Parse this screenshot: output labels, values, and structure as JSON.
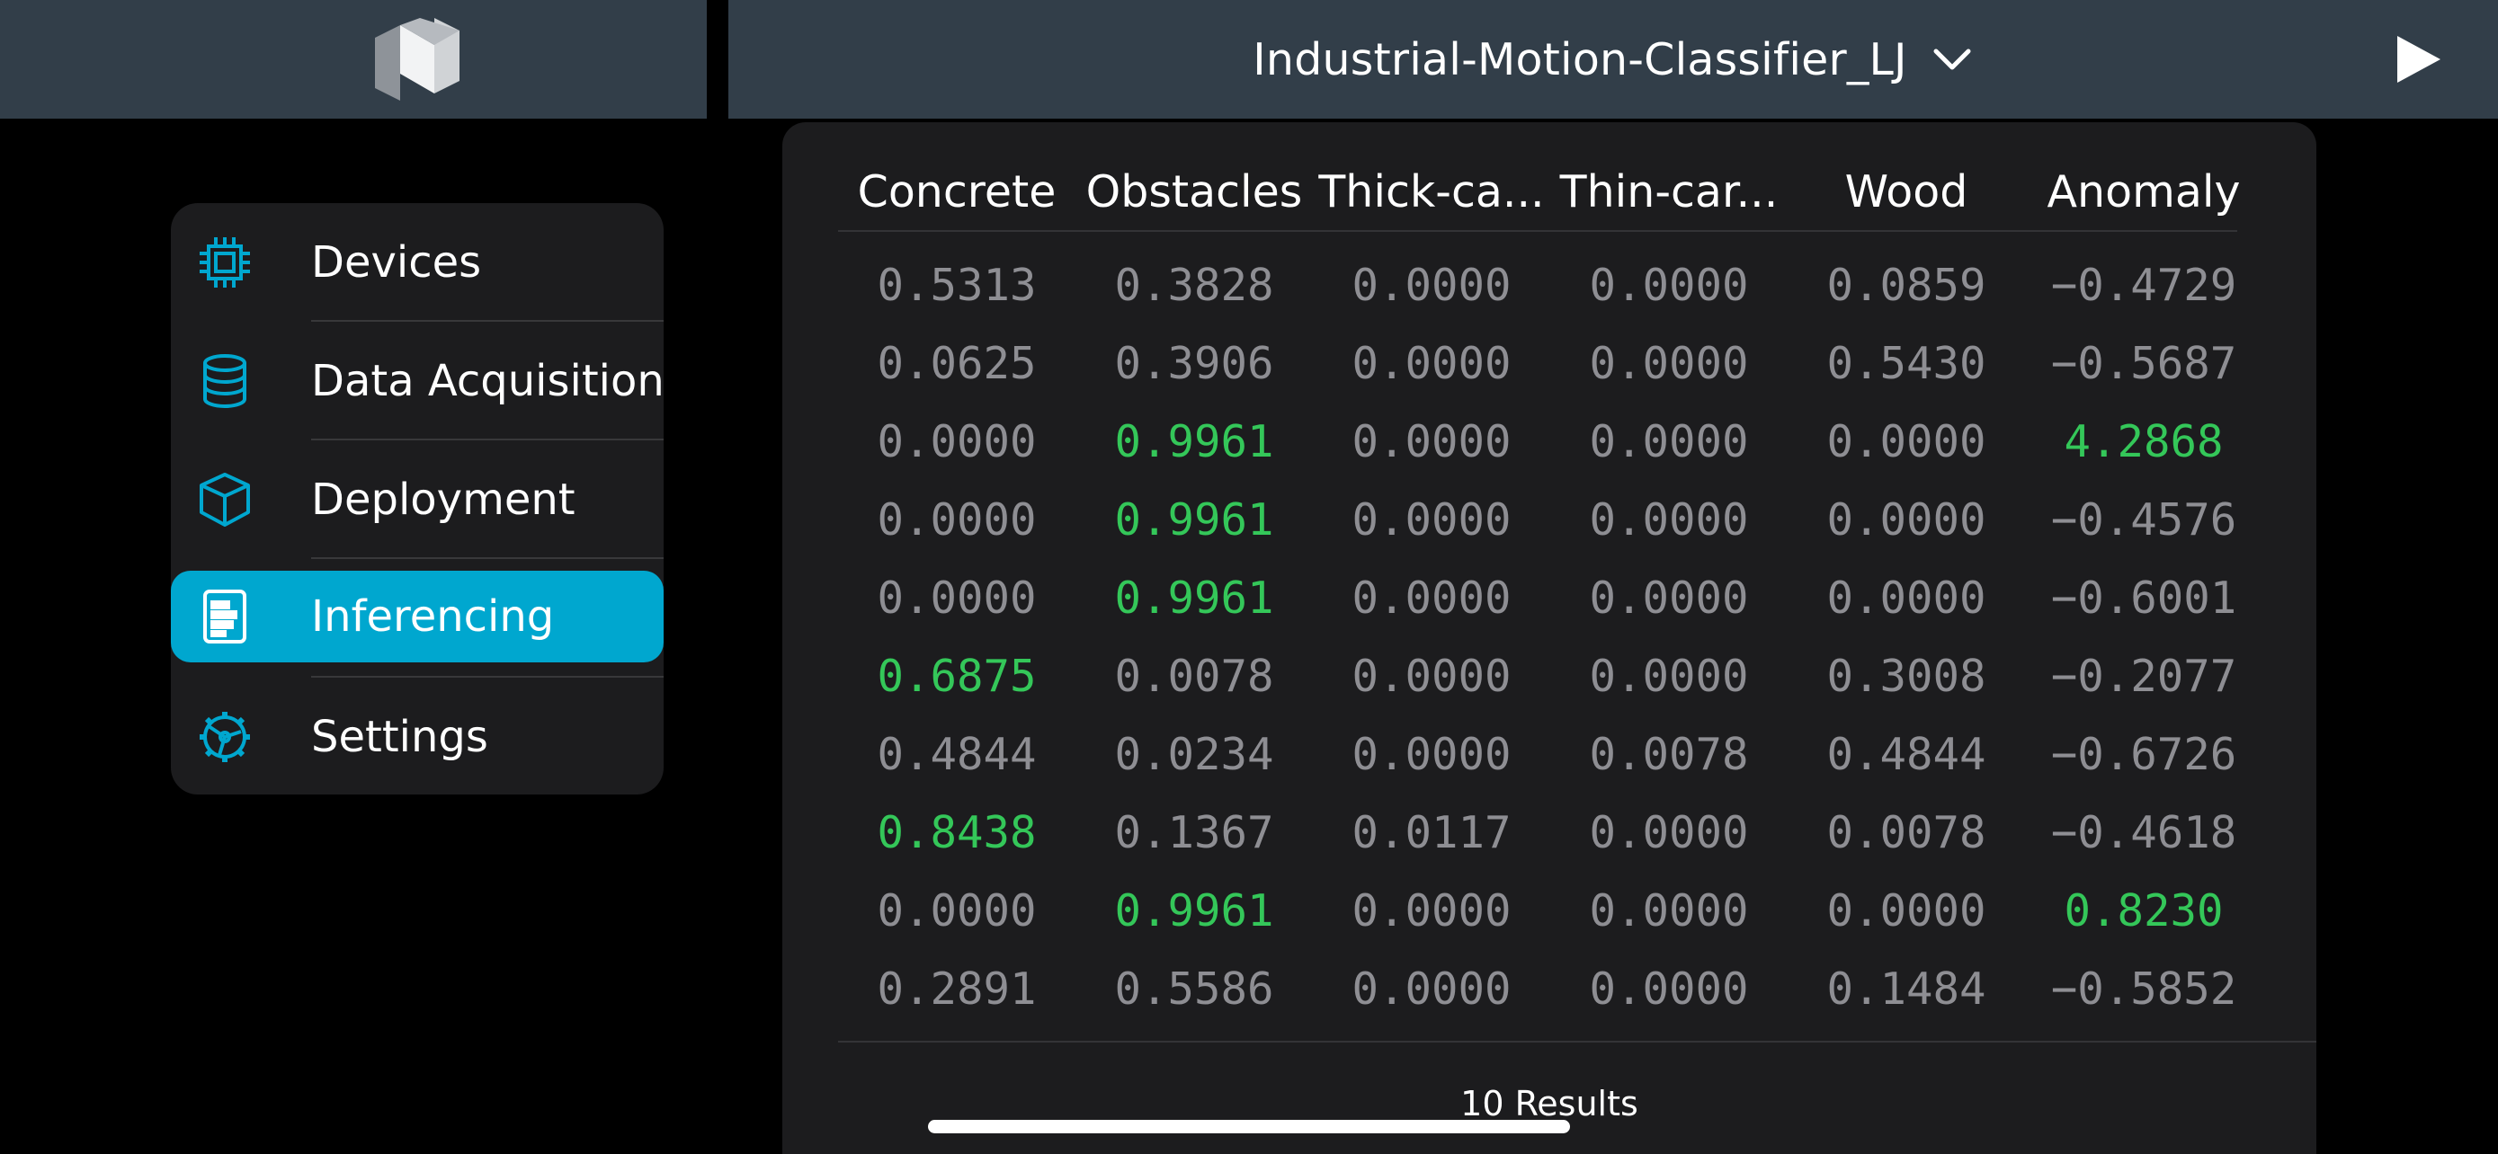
{
  "header": {
    "project_title": "Industrial-Motion-Classifier_LJ",
    "logo_icon": "edge-impulse-logo",
    "chevron_icon": "chevron-down-icon",
    "play_icon": "play-icon"
  },
  "sidebar": {
    "items": [
      {
        "label": "Devices",
        "icon": "chip-icon",
        "active": false
      },
      {
        "label": "Data Acquisition",
        "icon": "database-icon",
        "active": false
      },
      {
        "label": "Deployment",
        "icon": "box-icon",
        "active": false
      },
      {
        "label": "Inferencing",
        "icon": "report-icon",
        "active": true
      },
      {
        "label": "Settings",
        "icon": "gear-icon",
        "active": false
      }
    ]
  },
  "table": {
    "columns": [
      "Concrete",
      "Obstacles",
      "Thick-ca...",
      "Thin-car...",
      "Wood",
      "Anomaly"
    ],
    "rows": [
      [
        "0.5313",
        "0.3828",
        "0.0000",
        "0.0000",
        "0.0859",
        "−0.4729"
      ],
      [
        "0.0625",
        "0.3906",
        "0.0000",
        "0.0000",
        "0.5430",
        "−0.5687"
      ],
      [
        "0.0000",
        "0.9961",
        "0.0000",
        "0.0000",
        "0.0000",
        "4.2868"
      ],
      [
        "0.0000",
        "0.9961",
        "0.0000",
        "0.0000",
        "0.0000",
        "−0.4576"
      ],
      [
        "0.0000",
        "0.9961",
        "0.0000",
        "0.0000",
        "0.0000",
        "−0.6001"
      ],
      [
        "0.6875",
        "0.0078",
        "0.0000",
        "0.0000",
        "0.3008",
        "−0.2077"
      ],
      [
        "0.4844",
        "0.0234",
        "0.0000",
        "0.0078",
        "0.4844",
        "−0.6726"
      ],
      [
        "0.8438",
        "0.1367",
        "0.0117",
        "0.0000",
        "0.0078",
        "−0.4618"
      ],
      [
        "0.0000",
        "0.9961",
        "0.0000",
        "0.0000",
        "0.0000",
        "0.8230"
      ],
      [
        "0.2891",
        "0.5586",
        "0.0000",
        "0.0000",
        "0.1484",
        "−0.5852"
      ]
    ],
    "highlighted": [
      [],
      [],
      [
        1,
        5
      ],
      [
        1
      ],
      [
        1
      ],
      [
        0
      ],
      [],
      [
        0
      ],
      [
        1,
        5
      ],
      []
    ],
    "results_label": "10 Results"
  },
  "colors": {
    "accent": "#00a7cf",
    "highlight": "#34c759",
    "value_text": "#8e8e93",
    "topbar": "#323e49"
  }
}
